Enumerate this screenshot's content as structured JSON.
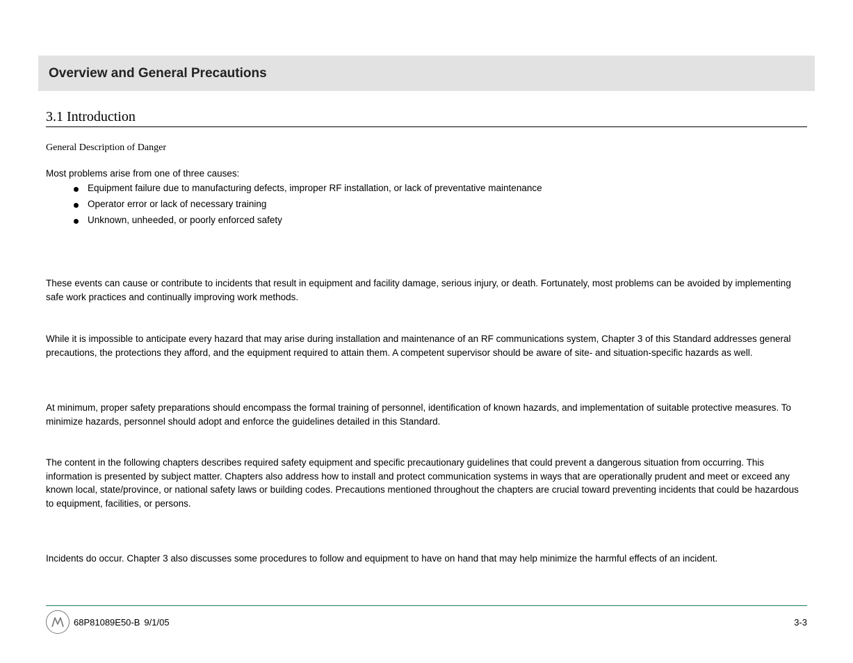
{
  "header": {
    "title": "Overview and General Precautions"
  },
  "section": {
    "heading": "3.1 Introduction",
    "subtitle": "General Description of Danger",
    "intro": "Most problems arise from one of three causes:",
    "causes": [
      "Equipment failure due to manufacturing defects, improper RF installation, or lack of preventative maintenance",
      "Operator error or lack of necessary training",
      "Unknown, unheeded, or poorly enforced safety"
    ],
    "paragraphs": [
      "These events can cause or contribute to incidents that result in equipment and facility damage, serious injury, or death. Fortunately, most problems can be avoided by implementing safe work practices and continually improving work methods.",
      "While it is impossible to anticipate every hazard that may arise during installation and maintenance of an RF communications system, Chapter 3 of this Standard addresses general precautions, the protections they afford, and the equipment required to attain them. A competent supervisor should be aware of site- and situation-specific hazards as well.",
      "At minimum, proper safety preparations should encompass the formal training of personnel, identification of known hazards, and implementation of suitable protective measures. To minimize hazards, personnel should adopt and enforce the guidelines detailed in this Standard.",
      "The content in the following chapters describes required safety equipment and specific precautionary guidelines that could prevent a dangerous situation from occurring. This information is presented by subject matter. Chapters also address how to install and protect communication systems in ways that are operationally prudent and meet or exceed any known local, state/province, or national safety laws or building codes. Precautions mentioned throughout the chapters are crucial toward preventing incidents that could be hazardous to equipment, facilities, or persons.",
      "Incidents do occur. Chapter 3 also discusses some procedures to follow and equipment to have on hand that may help minimize the harmful effects of an incident."
    ]
  },
  "footer": {
    "standard_label": "68P81089E50-B",
    "date": "9/1/05",
    "page": "3-3"
  }
}
